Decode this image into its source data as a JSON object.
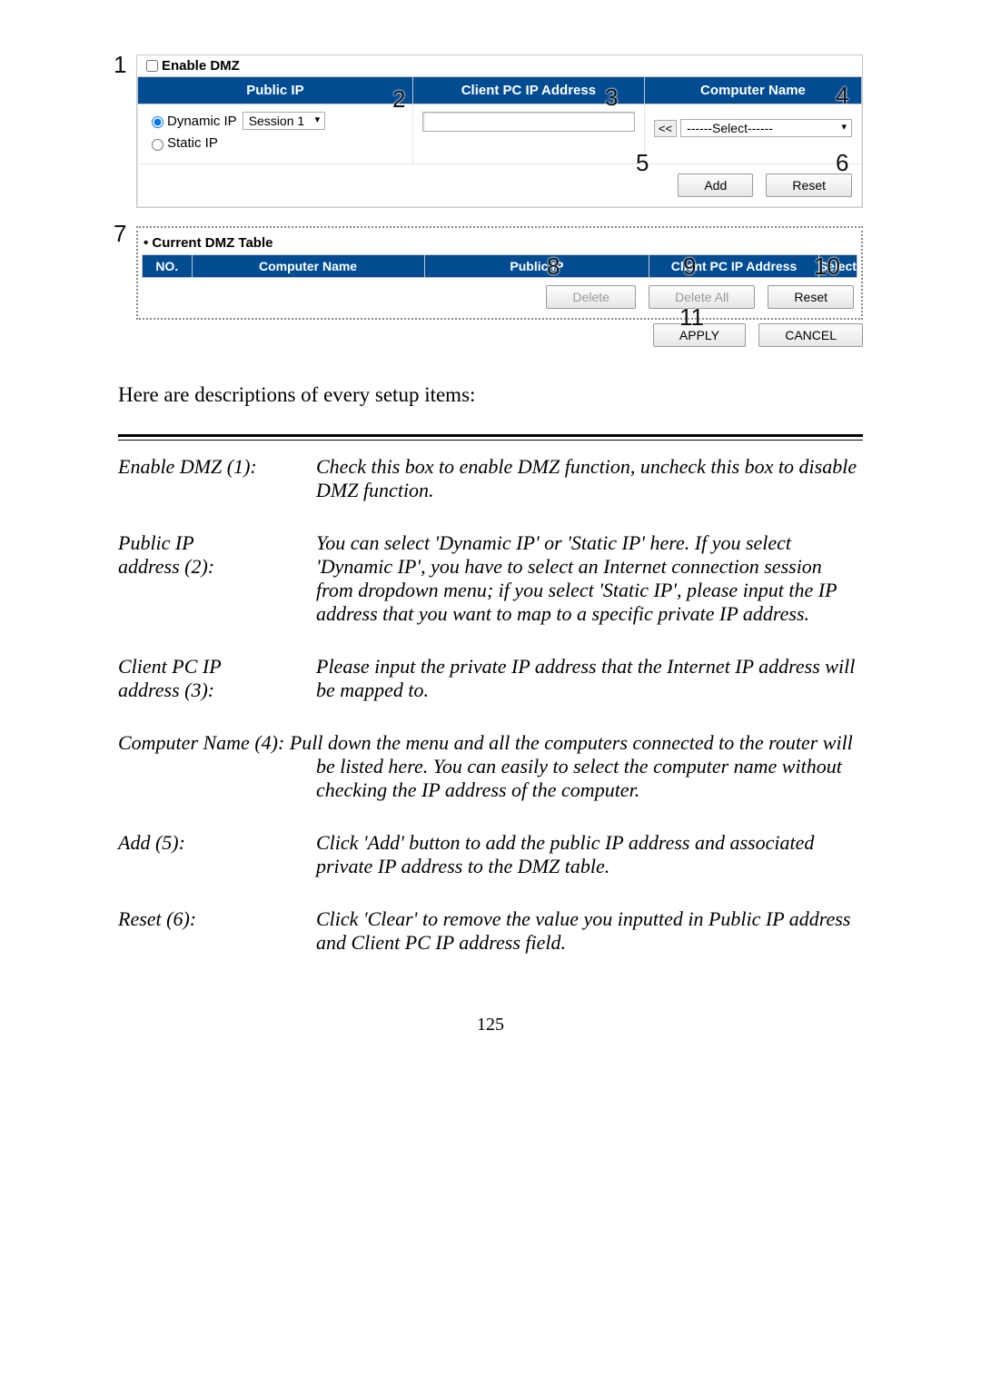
{
  "screenshot": {
    "enable_dmz_label": "Enable DMZ",
    "headers": {
      "public_ip": "Public IP",
      "client_ip": "Client PC IP Address",
      "computer_name": "Computer Name"
    },
    "public_ip": {
      "dynamic_label": "Dynamic IP",
      "session_value": "Session 1",
      "static_label": "Static IP"
    },
    "copy_btn": "<<",
    "computer_select_value": "------Select------",
    "buttons": {
      "add": "Add",
      "reset": "Reset",
      "delete": "Delete",
      "delete_all": "Delete All",
      "apply": "APPLY",
      "cancel": "CANCEL"
    },
    "current_table": {
      "title": "Current DMZ Table",
      "headers": {
        "no": "NO.",
        "computer_name": "Computer Name",
        "public_ip": "Public IP",
        "client_ip": "Client PC IP Address",
        "select": "Select"
      }
    },
    "callouts": {
      "n1": "1",
      "n2": "2",
      "n3": "3",
      "n4": "4",
      "n5": "5",
      "n6": "6",
      "n7": "7",
      "n8": "8",
      "n9": "9",
      "n10": "10",
      "n11": "11"
    }
  },
  "body": {
    "lead_text": "Here are descriptions of every setup items:",
    "items": [
      {
        "k": "Enable DMZ (1):",
        "v": "Check this box to enable DMZ function, uncheck this box to disable DMZ function."
      },
      {
        "k": "Public IP\naddress (2):",
        "v": "You can select 'Dynamic IP' or 'Static IP' here. If you select 'Dynamic IP', you have to select an Internet connection session from dropdown menu; if you select 'Static IP', please input the IP address that you want to map to a specific private IP address."
      },
      {
        "k": "Client PC IP\naddress (3):",
        "v": "Please input the private IP address that the Internet IP address will be mapped to."
      },
      {
        "k": "Computer Name (4):",
        "v": "Pull down the menu and all the computers connected to the router will be listed here. You can easily to select the computer name without checking the IP address of the computer.",
        "inline": true
      },
      {
        "k": "Add (5):",
        "v": "Click 'Add' button to add the public IP address and associated private IP address to the DMZ table."
      },
      {
        "k": "Reset (6):",
        "v": "Click 'Clear' to remove the value you inputted in Public IP address and Client PC IP address field."
      }
    ],
    "page_number": "125"
  }
}
